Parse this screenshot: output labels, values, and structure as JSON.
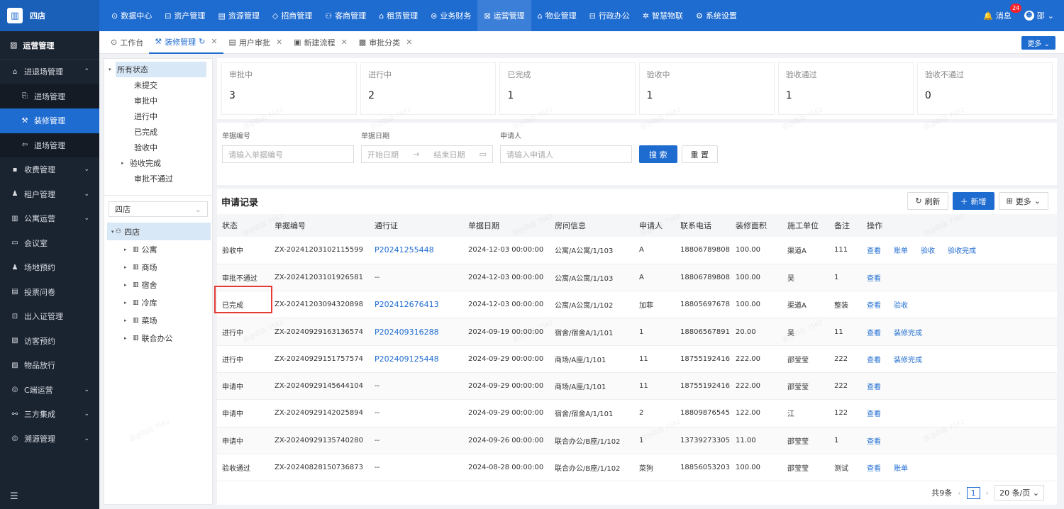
{
  "app": {
    "logo_text": "四店"
  },
  "topnav": [
    {
      "icon": "⊙",
      "label": "数据中心"
    },
    {
      "icon": "⊡",
      "label": "资产管理"
    },
    {
      "icon": "▤",
      "label": "资源管理"
    },
    {
      "icon": "◇",
      "label": "招商管理"
    },
    {
      "icon": "⚇",
      "label": "客商管理"
    },
    {
      "icon": "⌂",
      "label": "租赁管理"
    },
    {
      "icon": "⊜",
      "label": "业务财务"
    },
    {
      "icon": "⊠",
      "label": "运营管理"
    },
    {
      "icon": "⌂",
      "label": "物业管理"
    },
    {
      "icon": "⊟",
      "label": "行政办公"
    },
    {
      "icon": "✲",
      "label": "智慧物联"
    },
    {
      "icon": "⚙",
      "label": "系统设置"
    }
  ],
  "top_right": {
    "messages_label": "消息",
    "message_count": "24",
    "user_name": "邵"
  },
  "sidebar": {
    "title": "运营管理",
    "items": [
      {
        "icon": "⌂",
        "label": "进退场管理",
        "arrow": "⌃"
      },
      {
        "icon": "⎘",
        "label": "进场管理",
        "sub": true
      },
      {
        "icon": "⚒",
        "label": "装修管理",
        "sub": true,
        "active": true
      },
      {
        "icon": "⇦",
        "label": "退场管理",
        "sub": true
      },
      {
        "icon": "▪",
        "label": "收费管理",
        "arrow": "⌄"
      },
      {
        "icon": "♟",
        "label": "租户管理",
        "arrow": "⌄"
      },
      {
        "icon": "▥",
        "label": "公寓运营",
        "arrow": "⌄"
      },
      {
        "icon": "▭",
        "label": "会议室"
      },
      {
        "icon": "♟",
        "label": "场地预约"
      },
      {
        "icon": "▤",
        "label": "投票问卷"
      },
      {
        "icon": "⊡",
        "label": "出入证管理"
      },
      {
        "icon": "▧",
        "label": "访客预约"
      },
      {
        "icon": "▨",
        "label": "物品放行"
      },
      {
        "icon": "◎",
        "label": "C端运营",
        "arrow": "⌄"
      },
      {
        "icon": "⚯",
        "label": "三方集成",
        "arrow": "⌄"
      },
      {
        "icon": "◎",
        "label": "溯源管理",
        "arrow": "⌄"
      }
    ],
    "footer_icon": "☰"
  },
  "tabs": [
    {
      "icon": "⊙",
      "label": "工作台"
    },
    {
      "icon": "⚒",
      "label": "装修管理",
      "active": true,
      "refresh": "↻",
      "close": "✕"
    },
    {
      "icon": "▤",
      "label": "用户审批",
      "close": "✕"
    },
    {
      "icon": "▣",
      "label": "新建流程",
      "close": "✕"
    },
    {
      "icon": "▩",
      "label": "审批分类",
      "close": "✕"
    }
  ],
  "tab_more": "更多 ⌄",
  "status_tree": [
    {
      "label": "所有状态",
      "level": 0,
      "caret": "▾",
      "selected": true
    },
    {
      "label": "未提交",
      "level": 1
    },
    {
      "label": "审批中",
      "level": 1
    },
    {
      "label": "进行中",
      "level": 1
    },
    {
      "label": "已完成",
      "level": 1
    },
    {
      "label": "验收中",
      "level": 1
    },
    {
      "label": "验收完成",
      "level": 1,
      "caret": "▸"
    },
    {
      "label": "审批不通过",
      "level": 1
    }
  ],
  "store_select": {
    "value": "四店",
    "arrow": "⌄"
  },
  "building_tree": [
    {
      "label": "四店",
      "level": 0,
      "caret": "▾",
      "icon": "⚇",
      "selected": true
    },
    {
      "label": "公寓",
      "level": 1,
      "caret": "▸",
      "icon": "▥"
    },
    {
      "label": "商场",
      "level": 1,
      "caret": "▸",
      "icon": "▥"
    },
    {
      "label": "宿舍",
      "level": 1,
      "caret": "▸",
      "icon": "▥"
    },
    {
      "label": "冷库",
      "level": 1,
      "caret": "▸",
      "icon": "▥"
    },
    {
      "label": "菜场",
      "level": 1,
      "caret": "▸",
      "icon": "▥"
    },
    {
      "label": "联合办公",
      "level": 1,
      "caret": "▸",
      "icon": "▥"
    }
  ],
  "stats": [
    {
      "label": "审批中",
      "value": "3"
    },
    {
      "label": "进行中",
      "value": "2"
    },
    {
      "label": "已完成",
      "value": "1"
    },
    {
      "label": "验收中",
      "value": "1"
    },
    {
      "label": "验收通过",
      "value": "1"
    },
    {
      "label": "验收不通过",
      "value": "0"
    }
  ],
  "filter": {
    "doc_no_label": "单据编号",
    "doc_no_placeholder": "请输入单据编号",
    "date_label": "单据日期",
    "date_start": "开始日期",
    "date_arrow": "→",
    "date_end": "结束日期",
    "applicant_label": "申请人",
    "applicant_placeholder": "请输入申请人",
    "search": "搜 索",
    "reset": "重 置"
  },
  "records": {
    "title": "申请记录",
    "refresh": "刷新",
    "add": "新增",
    "more": "更多",
    "columns": [
      "状态",
      "单据编号",
      "通行证",
      "单据日期",
      "房间信息",
      "申请人",
      "联系电话",
      "装修面积",
      "施工单位",
      "备注",
      "操作"
    ],
    "rows": [
      {
        "status": "验收中",
        "no": "ZX-20241203102115599",
        "pass": "P20241255448",
        "date": "2024-12-03 00:00:00",
        "room": "公寓/A公寓/1/103",
        "applicant": "A",
        "phone": "18806789808",
        "area": "100.00",
        "unit": "渠道A",
        "note": "111",
        "ops": [
          "查看",
          "账单",
          "验收",
          "验收完成"
        ]
      },
      {
        "status": "审批不通过",
        "no": "ZX-20241203101926581",
        "pass": "--",
        "date": "2024-12-03 00:00:00",
        "room": "公寓/A公寓/1/103",
        "applicant": "A",
        "phone": "18806789808",
        "area": "100.00",
        "unit": "吴",
        "note": "1",
        "ops": [
          "查看"
        ]
      },
      {
        "status": "已完成",
        "no": "ZX-20241203094320898",
        "pass": "P202412676413",
        "date": "2024-12-03 00:00:00",
        "room": "公寓/A公寓/1/102",
        "applicant": "加菲",
        "phone": "18805697678",
        "area": "100.00",
        "unit": "渠道A",
        "note": "整装",
        "ops": [
          "查看",
          "验收"
        ]
      },
      {
        "status": "进行中",
        "no": "ZX-20240929163136574",
        "pass": "P202409316288",
        "date": "2024-09-19 00:00:00",
        "room": "宿舍/宿舍A/1/101",
        "applicant": "1",
        "phone": "18806567891",
        "area": "20.00",
        "unit": "吴",
        "note": "11",
        "ops": [
          "查看",
          "装修完成"
        ]
      },
      {
        "status": "进行中",
        "no": "ZX-20240929151757574",
        "pass": "P202409125448",
        "date": "2024-09-29 00:00:00",
        "room": "商场/A座/1/101",
        "applicant": "11",
        "phone": "18755192416",
        "area": "222.00",
        "unit": "邵莹莹",
        "note": "222",
        "ops": [
          "查看",
          "装修完成"
        ]
      },
      {
        "status": "申请中",
        "no": "ZX-20240929145644104",
        "pass": "--",
        "date": "2024-09-29 00:00:00",
        "room": "商场/A座/1/101",
        "applicant": "11",
        "phone": "18755192416",
        "area": "222.00",
        "unit": "邵莹莹",
        "note": "222",
        "ops": [
          "查看"
        ]
      },
      {
        "status": "申请中",
        "no": "ZX-20240929142025894",
        "pass": "--",
        "date": "2024-09-29 00:00:00",
        "room": "宿舍/宿舍A/1/101",
        "applicant": "2",
        "phone": "18809876545",
        "area": "122.00",
        "unit": "江",
        "note": "122",
        "ops": [
          "查看"
        ]
      },
      {
        "status": "申请中",
        "no": "ZX-20240929135740280",
        "pass": "--",
        "date": "2024-09-26 00:00:00",
        "room": "联合办公/B座/1/102",
        "applicant": "1",
        "phone": "13739273305",
        "area": "11.00",
        "unit": "邵莹莹",
        "note": "1",
        "ops": [
          "查看"
        ]
      },
      {
        "status": "验收通过",
        "no": "ZX-20240828150736873",
        "pass": "--",
        "date": "2024-08-28 00:00:00",
        "room": "联合办公/B座/1/102",
        "applicant": "菜狗",
        "phone": "18856053203",
        "area": "100.00",
        "unit": "邵莹莹",
        "note": "测试",
        "ops": [
          "查看",
          "账单"
        ]
      }
    ]
  },
  "pager": {
    "total": "共9条",
    "prev": "‹",
    "page": "1",
    "next": "›",
    "size": "20 条/页 ⌄"
  },
  "watermark": "邵@四店 7562",
  "colors": {
    "primary": "#1f6cd1",
    "sidebar": "#1a2330",
    "highlight": "#e53935"
  }
}
